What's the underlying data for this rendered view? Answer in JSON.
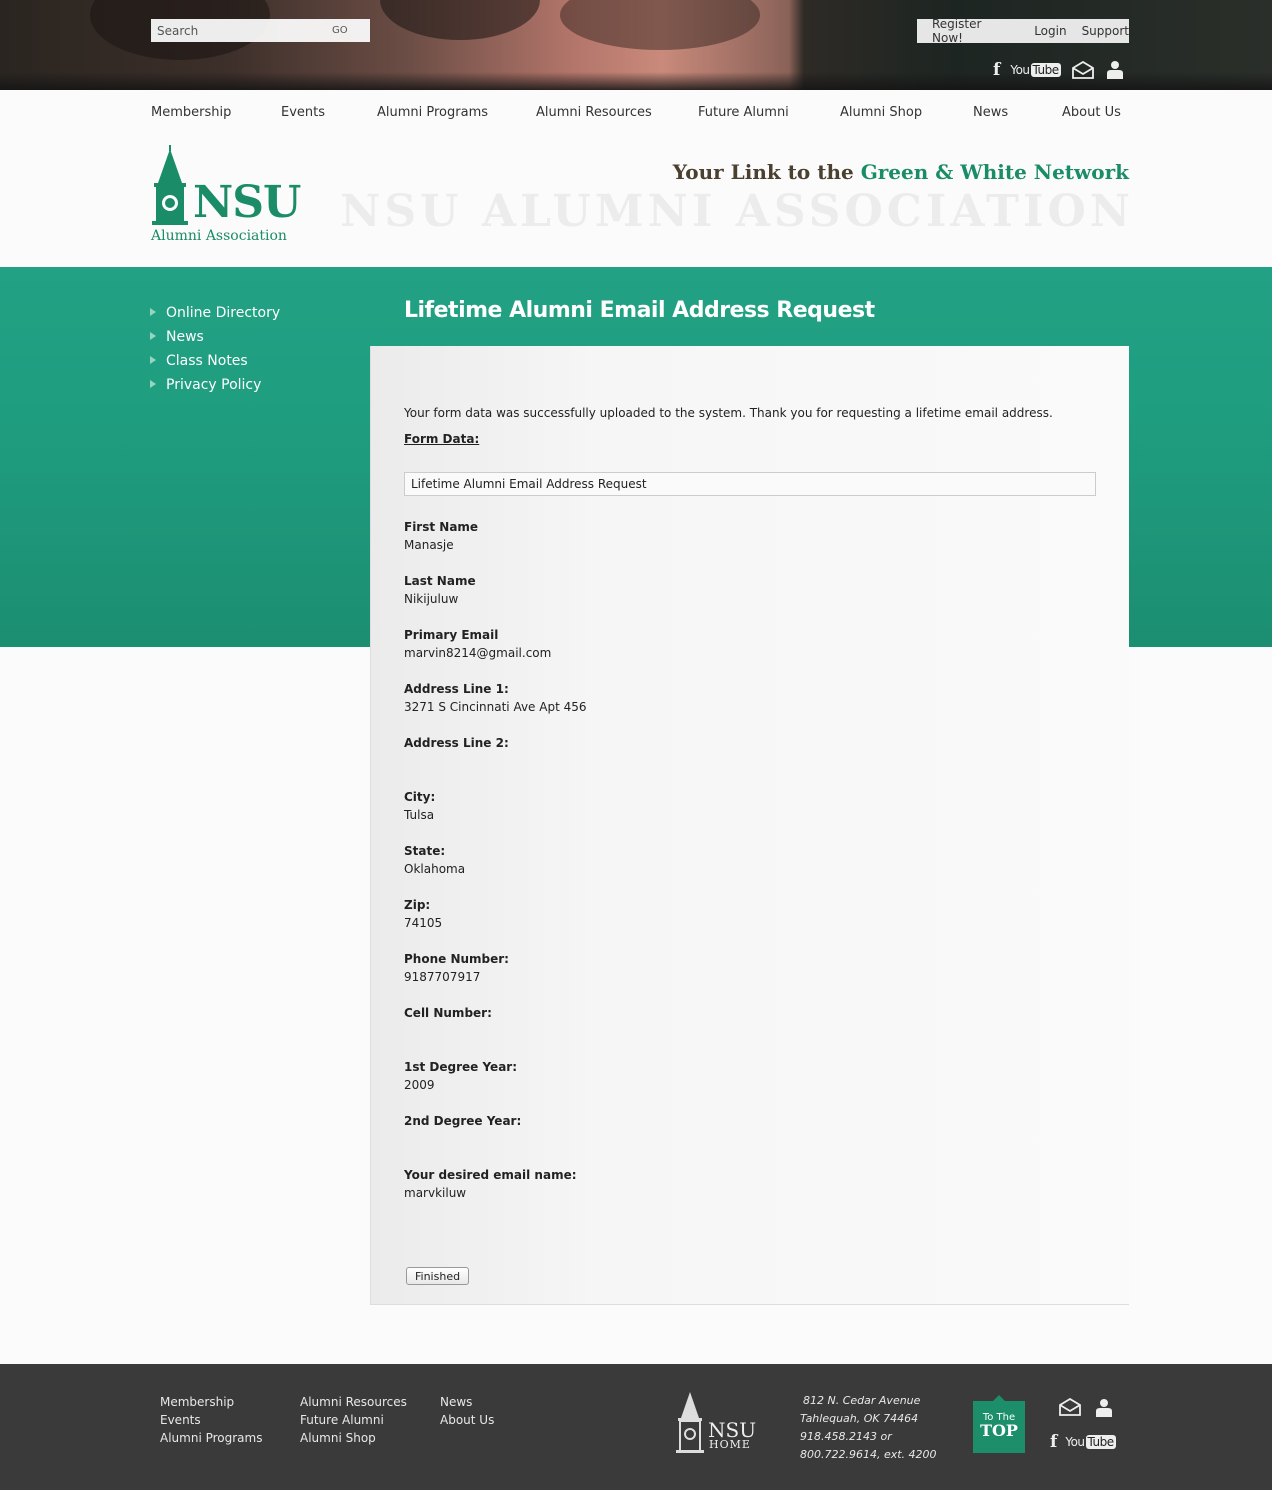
{
  "colors": {
    "green": "#1f9d7f",
    "brand_green": "#1a8c67",
    "footer_bg": "#3a3a3a"
  },
  "search": {
    "placeholder": "Search",
    "go_label": "GO"
  },
  "utility": {
    "register": "Register Now!",
    "login": "Login",
    "support": "Support"
  },
  "social_icons": [
    "facebook-icon",
    "youtube-icon",
    "envelope-icon",
    "person-icon"
  ],
  "youtube": {
    "you": "You",
    "tube": "Tube"
  },
  "facebook": "f",
  "nav": [
    "Membership",
    "Events",
    "Alumni Programs",
    "Alumni Resources",
    "Future Alumni",
    "Alumni Shop",
    "News",
    "About Us"
  ],
  "logo": {
    "nsu": "NSU",
    "sub": "Alumni Association"
  },
  "tagline": {
    "part1": "Your Link to the ",
    "part2": "Green & White Network"
  },
  "watermark": "NSU ALUMNI ASSOCIATION",
  "sidebar": [
    "Online Directory",
    "News",
    "Class Notes",
    "Privacy Policy"
  ],
  "page_title": "Lifetime Alumni Email Address Request",
  "content": {
    "intro": "Your form data was successfully uploaded to the system.  Thank you for requesting a lifetime email address.",
    "form_data_label": "Form Data:",
    "form_title": "Lifetime Alumni Email Address Request",
    "fields": [
      {
        "label": "First Name",
        "value": "Manasje"
      },
      {
        "label": "Last Name",
        "value": "Nikijuluw"
      },
      {
        "label": "Primary Email",
        "value": "marvin8214@gmail.com"
      },
      {
        "label": "Address Line 1:",
        "value": "3271 S Cincinnati Ave Apt 456"
      },
      {
        "label": "Address Line 2:",
        "value": ""
      },
      {
        "label": "City:",
        "value": "Tulsa"
      },
      {
        "label": "State:",
        "value": "Oklahoma"
      },
      {
        "label": "Zip:",
        "value": "74105"
      },
      {
        "label": "Phone Number:",
        "value": "9187707917"
      },
      {
        "label": "Cell Number:",
        "value": ""
      },
      {
        "label": "1st Degree Year:",
        "value": "2009"
      },
      {
        "label": "2nd Degree Year:",
        "value": ""
      },
      {
        "label": "Your desired email name:",
        "value": "marvkiluw"
      }
    ],
    "finished_button": "Finished"
  },
  "footer": {
    "col1": [
      "Membership",
      "Events",
      "Alumni Programs"
    ],
    "col2": [
      "Alumni Resources",
      "Future Alumni",
      "Alumni Shop"
    ],
    "col3": [
      "News",
      "About Us"
    ],
    "nsu_home": {
      "nsu": "NSU",
      "home": "HOME"
    },
    "address": [
      "812 N. Cedar Avenue",
      "Tahlequah, OK  74464",
      "918.458.2143 or",
      "800.722.9614, ext. 4200"
    ],
    "to_top": {
      "line1": "To The",
      "line2": "TOP"
    }
  }
}
